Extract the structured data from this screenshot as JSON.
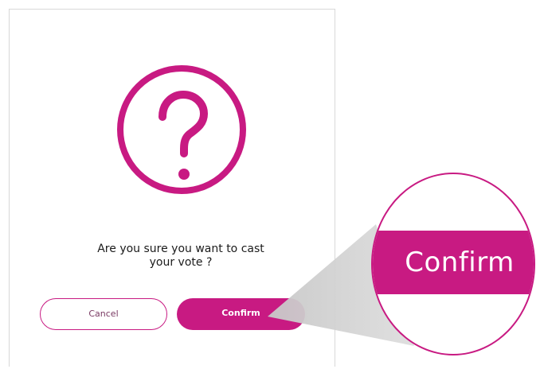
{
  "dialog": {
    "question_line_1": "Are you sure you want to cast",
    "question_line_2": "your vote ?",
    "cancel_label": "Cancel",
    "confirm_label": "Confirm",
    "icon": "question-mark-circle-icon"
  },
  "magnifier": {
    "label": "Confirm"
  },
  "colors": {
    "accent": "#c81a82",
    "text": "#1b1b1b",
    "border": "#d8d8d8",
    "cone": "#c8c8c8"
  }
}
